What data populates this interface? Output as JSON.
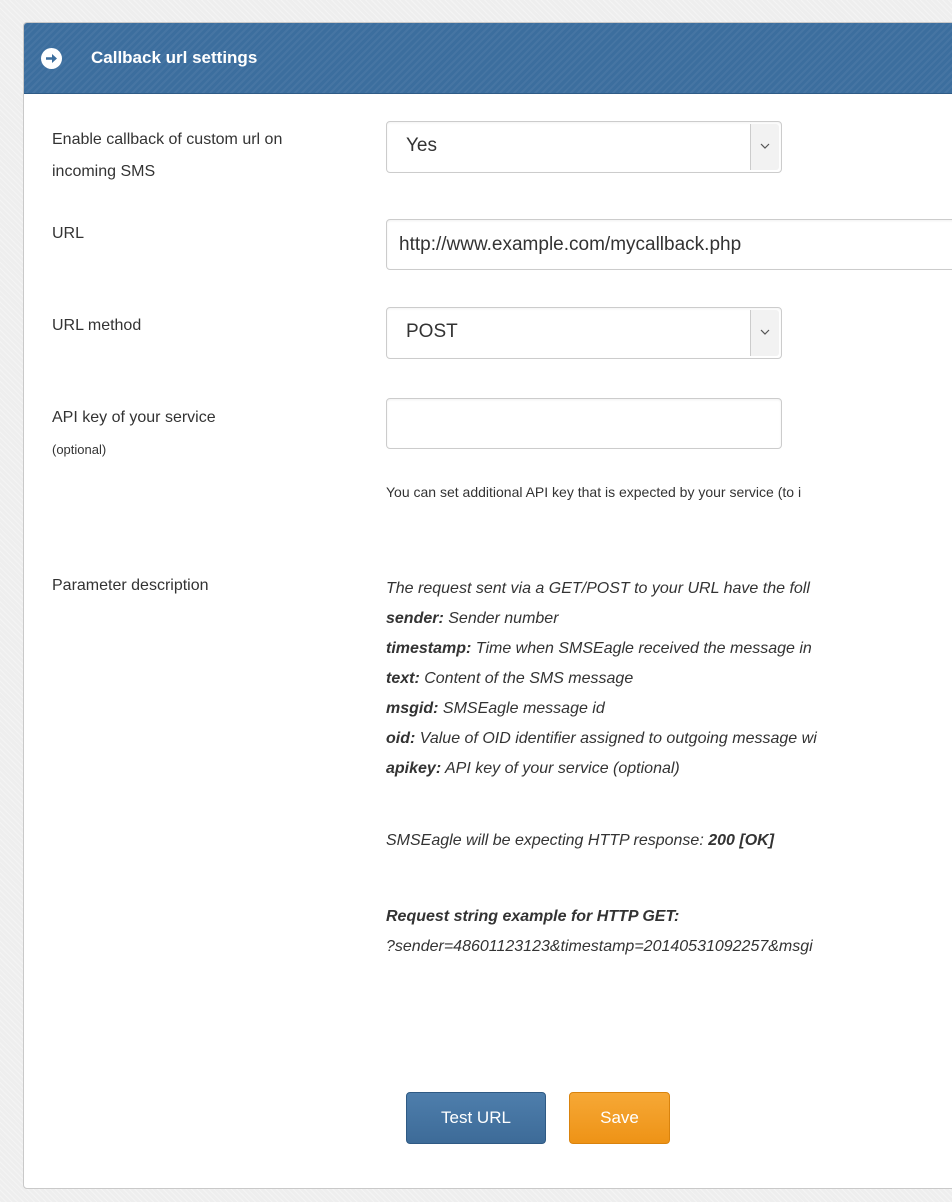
{
  "panel": {
    "title": "Callback url settings"
  },
  "fields": {
    "enable_label_line1": "Enable callback of custom url on",
    "enable_label_line2": "incoming SMS",
    "enable_value": "Yes",
    "url_label": "URL",
    "url_value": "http://www.example.com/mycallback.php",
    "method_label": "URL method",
    "method_value": "POST",
    "apikey_label": "API key of your service",
    "apikey_optional": "(optional)",
    "apikey_value": "",
    "apikey_help": "You can set additional API key that is expected by your service (to i"
  },
  "params": {
    "label": "Parameter description",
    "intro": "The request sent via a GET/POST to your URL have the foll",
    "items": [
      {
        "key": "sender:",
        "desc": " Sender number"
      },
      {
        "key": "timestamp:",
        "desc": " Time when SMSEagle received the message in"
      },
      {
        "key": "text:",
        "desc": " Content of the SMS message"
      },
      {
        "key": "msgid:",
        "desc": " SMSEagle message id"
      },
      {
        "key": "oid:",
        "desc": " Value of OID identifier assigned to outgoing message wi"
      },
      {
        "key": "apikey:",
        "desc": " API key of your service (optional)"
      }
    ],
    "response_text": "SMSEagle will be expecting HTTP response: ",
    "response_code": "200 [OK]",
    "example_title": "Request string example for HTTP GET:",
    "example_string": "?sender=48601123123&timestamp=20140531092257&msgi"
  },
  "buttons": {
    "test": "Test URL",
    "save": "Save"
  },
  "icons": {
    "header": "circle-arrow-right-icon",
    "dropdown": "chevron-down-icon"
  },
  "colors": {
    "header": "#3c6e9e",
    "test_button": "#4576a5",
    "save_button": "#f29e26"
  }
}
